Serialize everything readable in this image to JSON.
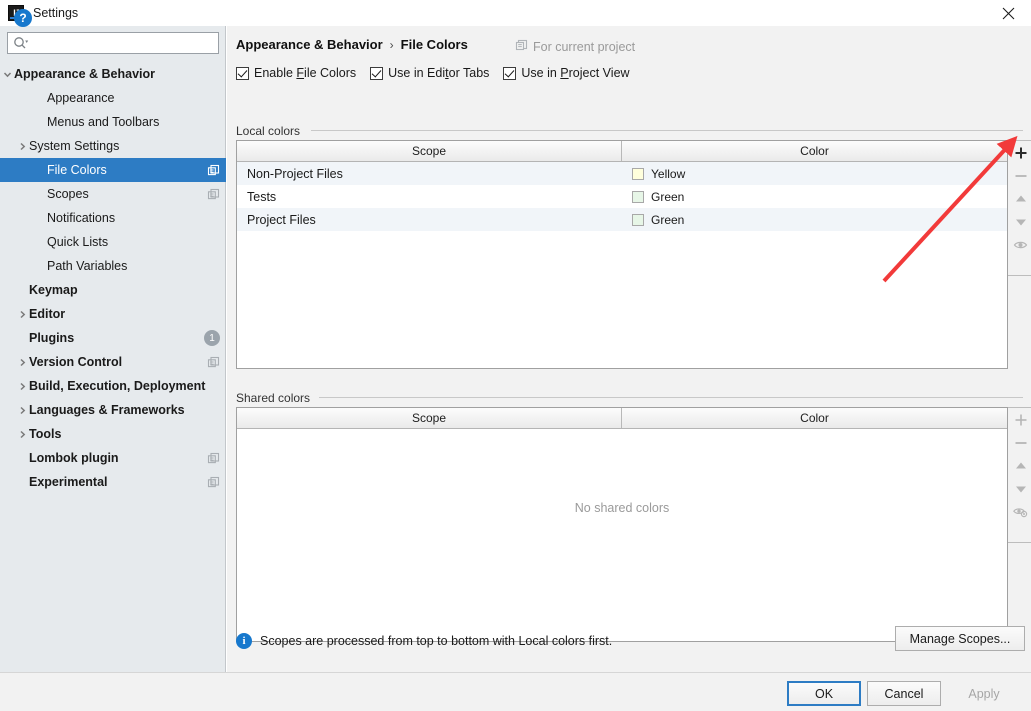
{
  "window": {
    "title": "Settings",
    "app_icon": "intellij-idea-icon",
    "close_icon": "close-icon"
  },
  "sidebar": {
    "search": {
      "value": "",
      "placeholder": "",
      "icon": "search-icon"
    },
    "items": [
      {
        "label": "Appearance & Behavior",
        "bold": true,
        "indent": 8,
        "twisty": "expanded",
        "scope_icon": false,
        "selected": false,
        "badge": ""
      },
      {
        "label": "Appearance",
        "bold": false,
        "indent": 47,
        "twisty": "none",
        "scope_icon": false,
        "selected": false,
        "badge": ""
      },
      {
        "label": "Menus and Toolbars",
        "bold": false,
        "indent": 47,
        "twisty": "none",
        "scope_icon": false,
        "selected": false,
        "badge": ""
      },
      {
        "label": "System Settings",
        "bold": false,
        "indent": 29,
        "twisty": "collapsed",
        "scope_icon": false,
        "selected": false,
        "badge": ""
      },
      {
        "label": "File Colors",
        "bold": false,
        "indent": 47,
        "twisty": "none",
        "scope_icon": true,
        "selected": true,
        "badge": ""
      },
      {
        "label": "Scopes",
        "bold": false,
        "indent": 47,
        "twisty": "none",
        "scope_icon": true,
        "selected": false,
        "badge": ""
      },
      {
        "label": "Notifications",
        "bold": false,
        "indent": 47,
        "twisty": "none",
        "scope_icon": false,
        "selected": false,
        "badge": ""
      },
      {
        "label": "Quick Lists",
        "bold": false,
        "indent": 47,
        "twisty": "none",
        "scope_icon": false,
        "selected": false,
        "badge": ""
      },
      {
        "label": "Path Variables",
        "bold": false,
        "indent": 47,
        "twisty": "none",
        "scope_icon": false,
        "selected": false,
        "badge": ""
      },
      {
        "label": "Keymap",
        "bold": true,
        "indent": 29,
        "twisty": "none",
        "scope_icon": false,
        "selected": false,
        "badge": ""
      },
      {
        "label": "Editor",
        "bold": true,
        "indent": 29,
        "twisty": "collapsed",
        "scope_icon": false,
        "selected": false,
        "badge": ""
      },
      {
        "label": "Plugins",
        "bold": true,
        "indent": 29,
        "twisty": "none",
        "scope_icon": false,
        "selected": false,
        "badge": "1"
      },
      {
        "label": "Version Control",
        "bold": true,
        "indent": 29,
        "twisty": "collapsed",
        "scope_icon": true,
        "selected": false,
        "badge": ""
      },
      {
        "label": "Build, Execution, Deployment",
        "bold": true,
        "indent": 29,
        "twisty": "collapsed",
        "scope_icon": false,
        "selected": false,
        "badge": ""
      },
      {
        "label": "Languages & Frameworks",
        "bold": true,
        "indent": 29,
        "twisty": "collapsed",
        "scope_icon": false,
        "selected": false,
        "badge": ""
      },
      {
        "label": "Tools",
        "bold": true,
        "indent": 29,
        "twisty": "collapsed",
        "scope_icon": false,
        "selected": false,
        "badge": ""
      },
      {
        "label": "Lombok plugin",
        "bold": true,
        "indent": 29,
        "twisty": "none",
        "scope_icon": true,
        "selected": false,
        "badge": ""
      },
      {
        "label": "Experimental",
        "bold": true,
        "indent": 29,
        "twisty": "none",
        "scope_icon": true,
        "selected": false,
        "badge": ""
      }
    ]
  },
  "main": {
    "breadcrumb": {
      "parent": "Appearance & Behavior",
      "separator": "›",
      "current": "File Colors"
    },
    "for_project": {
      "label": "For current project",
      "icon": "project-scope-icon"
    },
    "checkboxes": [
      {
        "label_before": "Enable ",
        "mnemonic": "F",
        "label_after": "ile Colors",
        "checked": true
      },
      {
        "label_before": "Use in Edi",
        "mnemonic": "t",
        "label_after": "or Tabs",
        "checked": true
      },
      {
        "label_before": "Use in ",
        "mnemonic": "P",
        "label_after": "roject View",
        "checked": true
      }
    ],
    "local": {
      "group_label": "Local colors",
      "columns": [
        "Scope",
        "Color"
      ],
      "rows": [
        {
          "scope": "Non-Project Files",
          "color_name": "Yellow",
          "color_hex": "#ffffdc"
        },
        {
          "scope": "Tests",
          "color_name": "Green",
          "color_hex": "#e7f6e7"
        },
        {
          "scope": "Project Files",
          "color_name": "Green",
          "color_hex": "#e7f6e7"
        }
      ],
      "toolbar": [
        {
          "icon": "add-icon",
          "enabled": true
        },
        {
          "icon": "remove-icon",
          "enabled": false
        },
        {
          "icon": "move-up-icon",
          "enabled": false
        },
        {
          "icon": "move-down-icon",
          "enabled": false
        },
        {
          "icon": "share-eye-icon",
          "enabled": false
        }
      ]
    },
    "shared": {
      "group_label": "Shared colors",
      "columns": [
        "Scope",
        "Color"
      ],
      "rows": [],
      "empty_message": "No shared colors",
      "toolbar": [
        {
          "icon": "add-icon",
          "enabled": false
        },
        {
          "icon": "remove-icon",
          "enabled": false
        },
        {
          "icon": "move-up-icon",
          "enabled": false
        },
        {
          "icon": "move-down-icon",
          "enabled": false
        },
        {
          "icon": "unshare-icon",
          "enabled": false
        }
      ]
    },
    "info": {
      "icon": "info-icon",
      "text": "Scopes are processed from top to bottom with Local colors first."
    },
    "manage_scopes_label": "Manage Scopes..."
  },
  "footer": {
    "help_label": "?",
    "ok_label": "OK",
    "cancel_label": "Cancel",
    "apply_label": "Apply"
  },
  "annotation": {
    "type": "red-arrow",
    "color": "#f23a3a",
    "points_to": "add-icon-local-colors"
  },
  "colors": {
    "accent": "#2d7cc4",
    "sidebar_bg": "#e6eaed",
    "panel_bg": "#f2f2f2",
    "row_alt": "#f1f5f9"
  }
}
